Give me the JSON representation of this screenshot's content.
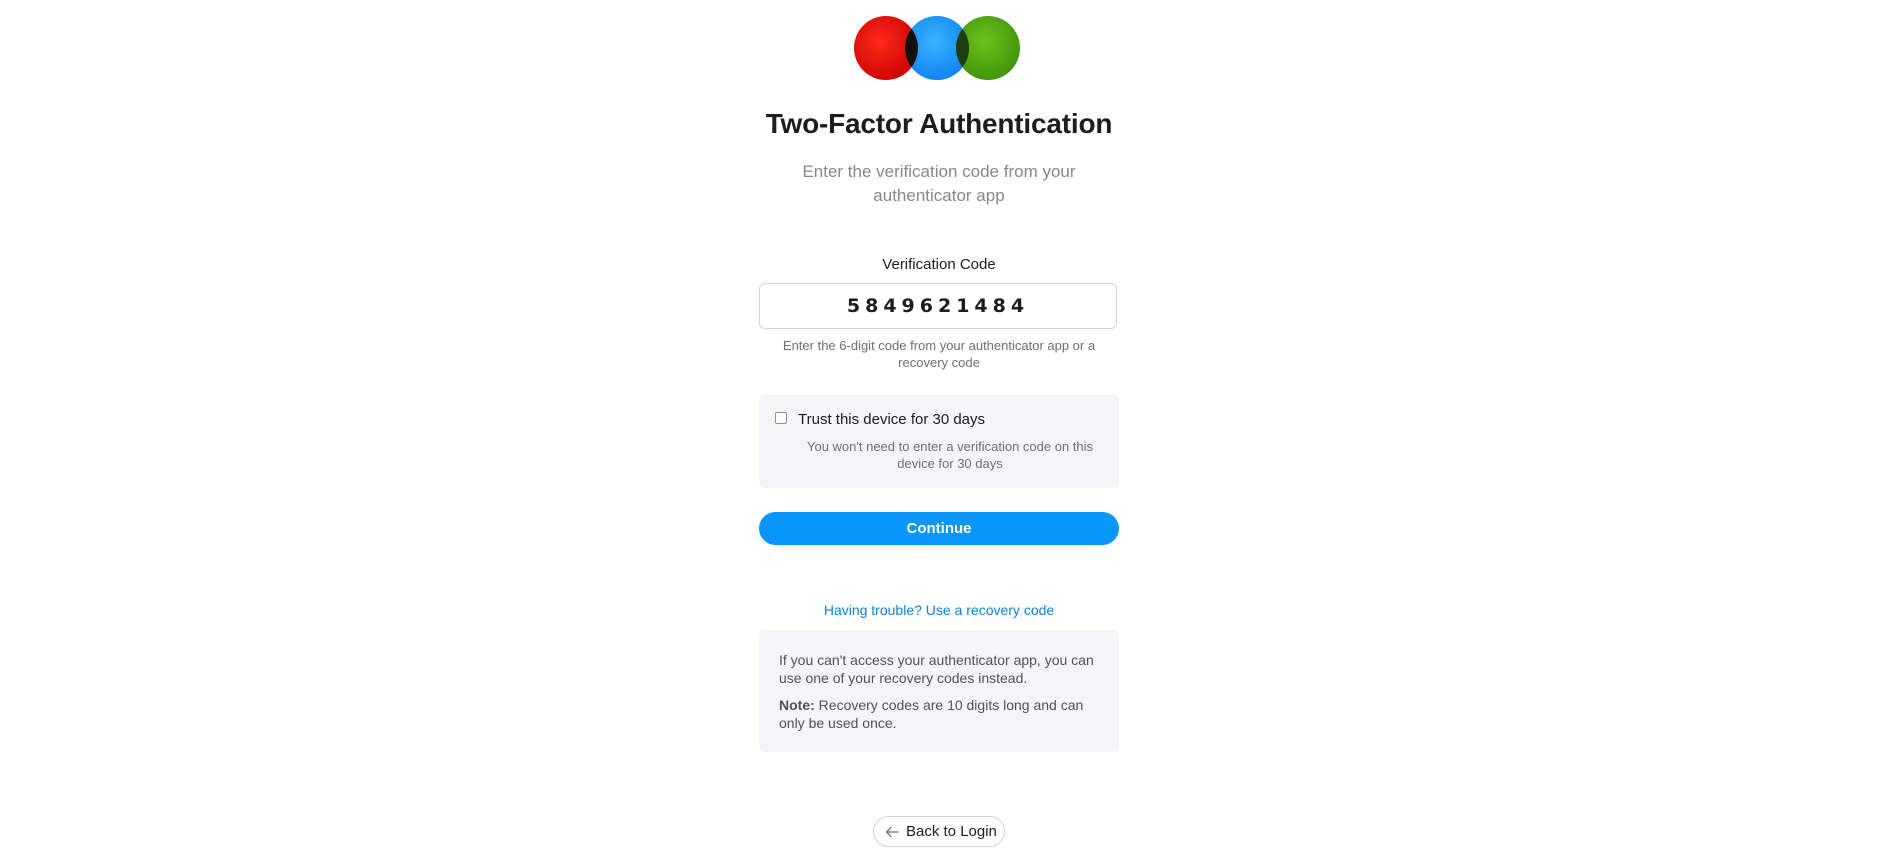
{
  "logo": {
    "name": "three-circle-logo",
    "colors": [
      "#e30000",
      "#0a8cff",
      "#46a80c"
    ]
  },
  "header": {
    "title": "Two-Factor Authentication",
    "subtitle": "Enter the verification code from your authenticator app"
  },
  "verification": {
    "label": "Verification Code",
    "value": "5849621484",
    "hint": "Enter the 6-digit code from your authenticator app or a recovery code"
  },
  "trust": {
    "checked": false,
    "label": "Trust this device for 30 days",
    "description": "You won't need to enter a verification code on this device for 30 days"
  },
  "actions": {
    "continue_label": "Continue",
    "recovery_link": "Having trouble? Use a recovery code",
    "back_label": "Back to Login",
    "back_icon": "arrow-left-icon"
  },
  "info": {
    "text": "If you can't access your authenticator app, you can use one of your recovery codes instead.",
    "note_label": "Note:",
    "note_text": " Recovery codes are 10 digits long and can only be used once."
  },
  "colors": {
    "accent": "#0a95ff",
    "link": "#0a84d6",
    "panel": "#f5f5f7"
  }
}
